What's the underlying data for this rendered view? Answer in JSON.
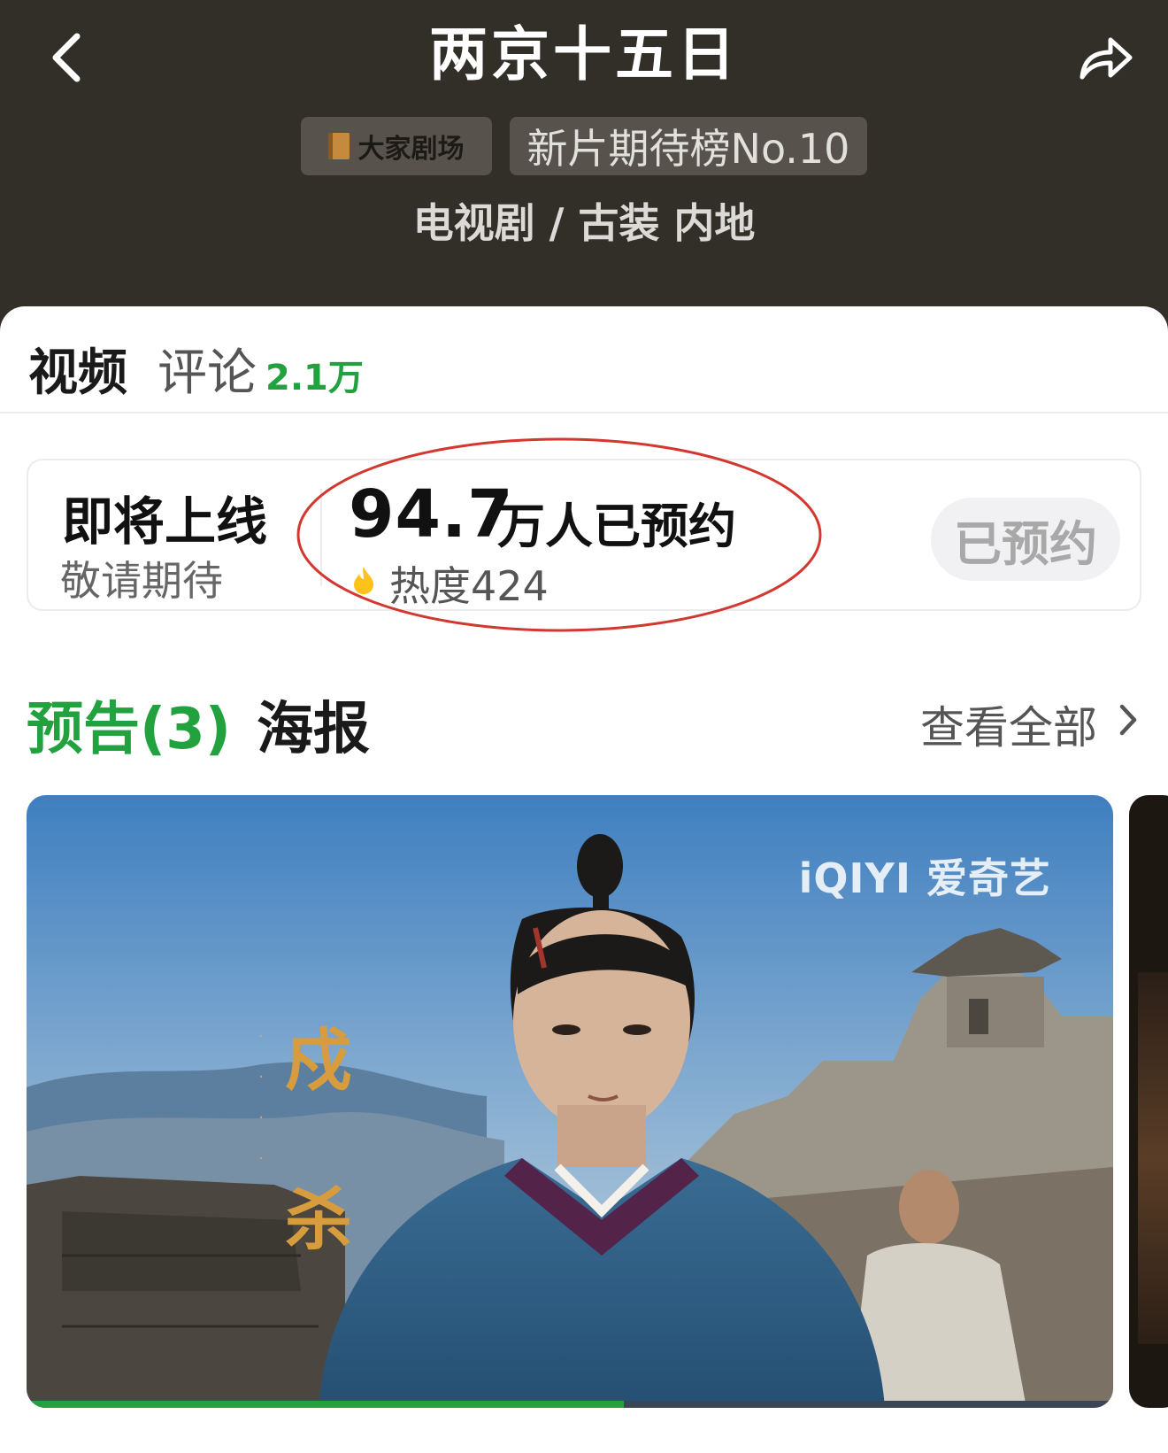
{
  "header": {
    "title": "两京十五日",
    "back_icon": "chevron-left-icon",
    "share_icon": "share-arrow-icon",
    "theater_tag": "大家剧场",
    "rank_tag": "新片期待榜No.10",
    "genre": "电视剧 / 古装 内地"
  },
  "tabs": {
    "video": "视频",
    "comments": "评论",
    "comment_count": "2.1万"
  },
  "reservation": {
    "status_title": "即将上线",
    "status_subtitle": "敬请期待",
    "count": "94.7",
    "count_suffix": "万人已预约",
    "heat": "热度424",
    "button_label": "已预约"
  },
  "section": {
    "trailers": "预告(3)",
    "posters": "海报",
    "see_all": "查看全部"
  },
  "video": {
    "watermark": "iQIYI 爱奇艺",
    "poster_text": "戍杀",
    "progress": 0.55
  },
  "colors": {
    "header_bg": "#322f29",
    "accent_green": "#22a13f",
    "annotation_red": "#d2382f"
  }
}
